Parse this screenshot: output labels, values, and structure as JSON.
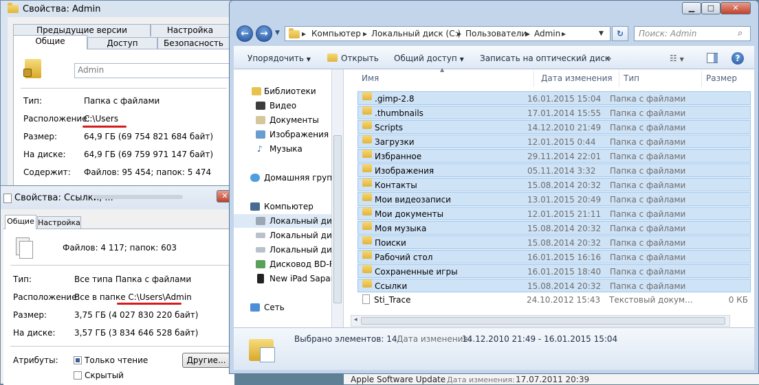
{
  "prop1": {
    "title": "Свойства: Admin",
    "tabs_row1": [
      "Предыдущие версии",
      "Настройка"
    ],
    "tabs_row2": [
      "Общие",
      "Доступ",
      "Безопасность"
    ],
    "name_value": "Admin",
    "rows": [
      {
        "label": "Тип:",
        "value": "Папка с файлами"
      },
      {
        "label": "Расположение:",
        "value": "C:\\Users"
      },
      {
        "label": "Размер:",
        "value": "64,9 ГБ (69 754 821 684 байт)"
      },
      {
        "label": "На диске:",
        "value": "64,9 ГБ (69 759 971 147 байт)"
      },
      {
        "label": "Содержит:",
        "value": "Файлов: 95 454; папок: 5 474"
      }
    ]
  },
  "prop2": {
    "title": "Свойства: Ссылки, ...",
    "tabs": [
      "Общие",
      "Настройка"
    ],
    "count_text": "Файлов: 4 117; папок: 603",
    "rows": [
      {
        "label": "Тип:",
        "value": "Все типа Папка с файлами"
      },
      {
        "label": "Расположение:",
        "value": "Все в папке C:\\Users\\Admin"
      },
      {
        "label": "Размер:",
        "value": "3,75 ГБ (4 027 830 220 байт)"
      },
      {
        "label": "На диске:",
        "value": "3,57 ГБ (3 834 646 528 байт)"
      }
    ],
    "attributes_label": "Атрибуты:",
    "readonly_label": "Только чтение",
    "hidden_label": "Скрытый",
    "other_button": "Другие..."
  },
  "explorer": {
    "caption_buttons": [
      "▁",
      "□",
      "✕"
    ],
    "breadcrumb": [
      "Компьютер",
      "Локальный диск (C:)",
      "Пользователи",
      "Admin"
    ],
    "search_placeholder": "Поиск: Admin",
    "toolbar": {
      "organize": "Упорядочить",
      "open": "Открыть",
      "share": "Общий доступ",
      "burn": "Записать на оптический диск",
      "more": "»"
    },
    "nav": {
      "libraries": "Библиотеки",
      "video": "Видео",
      "documents": "Документы",
      "images": "Изображения",
      "music": "Музыка",
      "homegroup": "Домашняя группа",
      "computer": "Компьютер",
      "local_c": "Локальный диск (C:)",
      "local_d": "Локальный диск (D:)",
      "local_e": "Локальный диск (E:)",
      "bd_rom": "Дисковод BD-ROM",
      "ipad": "New iPad Saparov",
      "network": "Сеть"
    },
    "columns": {
      "name": "Имя",
      "date": "Дата изменения",
      "type": "Тип",
      "size": "Размер"
    },
    "files": [
      {
        "name": ".gimp-2.8",
        "date": "16.01.2015 15:04",
        "type": "Папка с файлами",
        "size": "",
        "selected": true
      },
      {
        "name": ".thumbnails",
        "date": "17.01.2014 15:55",
        "type": "Папка с файлами",
        "size": "",
        "selected": true
      },
      {
        "name": "Scripts",
        "date": "14.12.2010 21:49",
        "type": "Папка с файлами",
        "size": "",
        "selected": true
      },
      {
        "name": "Загрузки",
        "date": "12.01.2015 0:44",
        "type": "Папка с файлами",
        "size": "",
        "selected": true
      },
      {
        "name": "Избранное",
        "date": "29.11.2014 22:01",
        "type": "Папка с файлами",
        "size": "",
        "selected": true
      },
      {
        "name": "Изображения",
        "date": "05.11.2014 3:32",
        "type": "Папка с файлами",
        "size": "",
        "selected": true
      },
      {
        "name": "Контакты",
        "date": "15.08.2014 20:32",
        "type": "Папка с файлами",
        "size": "",
        "selected": true
      },
      {
        "name": "Мои видеозаписи",
        "date": "13.01.2015 20:49",
        "type": "Папка с файлами",
        "size": "",
        "selected": true
      },
      {
        "name": "Мои документы",
        "date": "12.01.2015 21:11",
        "type": "Папка с файлами",
        "size": "",
        "selected": true
      },
      {
        "name": "Моя музыка",
        "date": "15.08.2014 20:32",
        "type": "Папка с файлами",
        "size": "",
        "selected": true
      },
      {
        "name": "Поиски",
        "date": "15.08.2014 20:32",
        "type": "Папка с файлами",
        "size": "",
        "selected": true
      },
      {
        "name": "Рабочий стол",
        "date": "16.01.2015 16:16",
        "type": "Папка с файлами",
        "size": "",
        "selected": true
      },
      {
        "name": "Сохраненные игры",
        "date": "16.01.2015 18:40",
        "type": "Папка с файлами",
        "size": "",
        "selected": true
      },
      {
        "name": "Ссылки",
        "date": "15.08.2014 20:32",
        "type": "Папка с файлами",
        "size": "",
        "selected": true
      },
      {
        "name": "Sti_Trace",
        "date": "24.10.2012 15:43",
        "type": "Текстовый докум...",
        "size": "0 КБ",
        "selected": false
      }
    ],
    "details": {
      "selected": "Выбрано элементов: 14",
      "date_label": "Дата изменения:",
      "date_range": "14.12.2010 21:49 - 16.01.2015 15:04"
    }
  },
  "background_window": {
    "name": "Apple Software Update",
    "date_label": "Дата изменения:",
    "date": "17.07.2011 20:39"
  },
  "colors": {
    "selection": "#cfe3f7",
    "underline": "#d41a1a",
    "folder": "#e2b33a"
  }
}
